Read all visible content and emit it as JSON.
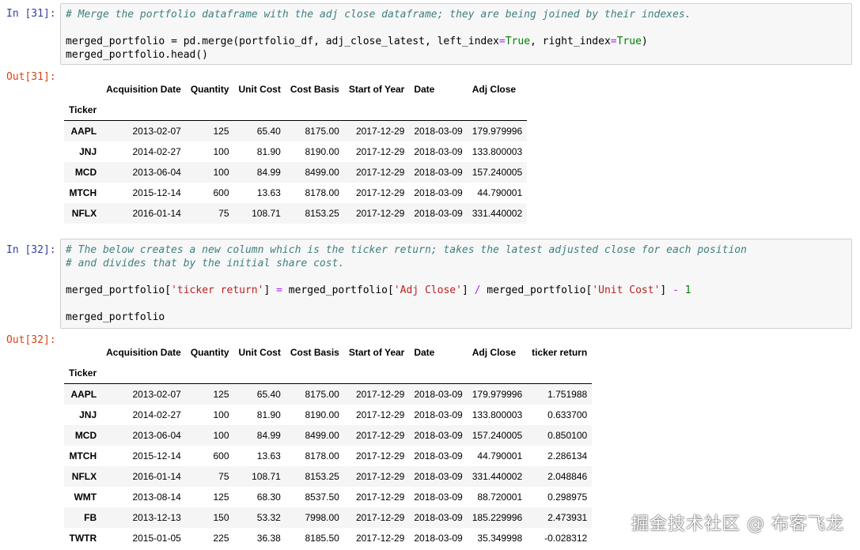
{
  "cells": [
    {
      "in_prompt": "In [31]:",
      "out_prompt": "Out[31]:",
      "code_comment": "# Merge the portfolio dataframe with the adj close dataframe; they are being joined by their indexes.",
      "code_line2_a": "merged_portfolio ",
      "code_line2_b": "= pd.merge(portfolio_df, adj_close_latest, left_index",
      "code_line2_c": "=",
      "code_line2_d": "True",
      "code_line2_e": ", right_index",
      "code_line2_f": "=",
      "code_line2_g": "True",
      "code_line2_h": ")",
      "code_line3": "merged_portfolio.head()"
    },
    {
      "in_prompt": "In [32]:",
      "out_prompt": "Out[32]:",
      "code_comment1": "# The below creates a new column which is the ticker return; takes the latest adjusted close for each position",
      "code_comment2": "# and divides that by the initial share cost.",
      "code_line_a": "merged_portfolio[",
      "code_line_b": "'ticker return'",
      "code_line_c": "] ",
      "code_line_d": "=",
      "code_line_e": " merged_portfolio[",
      "code_line_f": "'Adj Close'",
      "code_line_g": "] ",
      "code_line_h": "/",
      "code_line_i": " merged_portfolio[",
      "code_line_j": "'Unit Cost'",
      "code_line_k": "] ",
      "code_line_l": "-",
      "code_line_m": " ",
      "code_line_n": "1",
      "code_line_last": "merged_portfolio"
    }
  ],
  "table1": {
    "columns": [
      "Acquisition Date",
      "Quantity",
      "Unit Cost",
      "Cost Basis",
      "Start of Year",
      "Date",
      "Adj Close"
    ],
    "index_name": "Ticker",
    "rows": [
      [
        "AAPL",
        "2013-02-07",
        "125",
        "65.40",
        "8175.00",
        "2017-12-29",
        "2018-03-09",
        "179.979996"
      ],
      [
        "JNJ",
        "2014-02-27",
        "100",
        "81.90",
        "8190.00",
        "2017-12-29",
        "2018-03-09",
        "133.800003"
      ],
      [
        "MCD",
        "2013-06-04",
        "100",
        "84.99",
        "8499.00",
        "2017-12-29",
        "2018-03-09",
        "157.240005"
      ],
      [
        "MTCH",
        "2015-12-14",
        "600",
        "13.63",
        "8178.00",
        "2017-12-29",
        "2018-03-09",
        "44.790001"
      ],
      [
        "NFLX",
        "2016-01-14",
        "75",
        "108.71",
        "8153.25",
        "2017-12-29",
        "2018-03-09",
        "331.440002"
      ]
    ]
  },
  "table2": {
    "columns": [
      "Acquisition Date",
      "Quantity",
      "Unit Cost",
      "Cost Basis",
      "Start of Year",
      "Date",
      "Adj Close",
      "ticker return"
    ],
    "index_name": "Ticker",
    "rows": [
      [
        "AAPL",
        "2013-02-07",
        "125",
        "65.40",
        "8175.00",
        "2017-12-29",
        "2018-03-09",
        "179.979996",
        "1.751988"
      ],
      [
        "JNJ",
        "2014-02-27",
        "100",
        "81.90",
        "8190.00",
        "2017-12-29",
        "2018-03-09",
        "133.800003",
        "0.633700"
      ],
      [
        "MCD",
        "2013-06-04",
        "100",
        "84.99",
        "8499.00",
        "2017-12-29",
        "2018-03-09",
        "157.240005",
        "0.850100"
      ],
      [
        "MTCH",
        "2015-12-14",
        "600",
        "13.63",
        "8178.00",
        "2017-12-29",
        "2018-03-09",
        "44.790001",
        "2.286134"
      ],
      [
        "NFLX",
        "2016-01-14",
        "75",
        "108.71",
        "8153.25",
        "2017-12-29",
        "2018-03-09",
        "331.440002",
        "2.048846"
      ],
      [
        "WMT",
        "2013-08-14",
        "125",
        "68.30",
        "8537.50",
        "2017-12-29",
        "2018-03-09",
        "88.720001",
        "0.298975"
      ],
      [
        "FB",
        "2013-12-13",
        "150",
        "53.32",
        "7998.00",
        "2017-12-29",
        "2018-03-09",
        "185.229996",
        "2.473931"
      ],
      [
        "TWTR",
        "2015-01-05",
        "225",
        "36.38",
        "8185.50",
        "2017-12-29",
        "2018-03-09",
        "35.349998",
        "-0.028312"
      ]
    ]
  },
  "watermark": "掘金技术社区 @ 布客飞龙"
}
